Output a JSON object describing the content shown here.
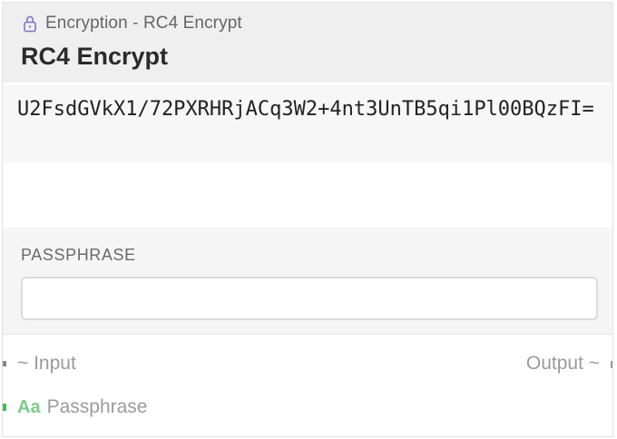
{
  "node": {
    "category": "Encryption - RC4 Encrypt",
    "title": "RC4 Encrypt",
    "output_value": "U2FsdGVkX1/72PXRHRjACq3W2+4nt3UnTB5qi1Pl00BQzFI=",
    "settings": {
      "passphrase_label": "PASSPHRASE",
      "passphrase_value": ""
    },
    "ports": {
      "input_label": "~ Input",
      "output_label": "Output ~",
      "passphrase_type_icon": "Aa",
      "passphrase_label": "Passphrase"
    }
  },
  "colors": {
    "header_bg": "#efefef",
    "category_icon": "#8b6fc9",
    "passphrase_port": "#4cb85c",
    "text_type_icon": "#7dcb8a"
  },
  "icons": {
    "category": "lock-icon",
    "string_type": "text-type-icon"
  }
}
